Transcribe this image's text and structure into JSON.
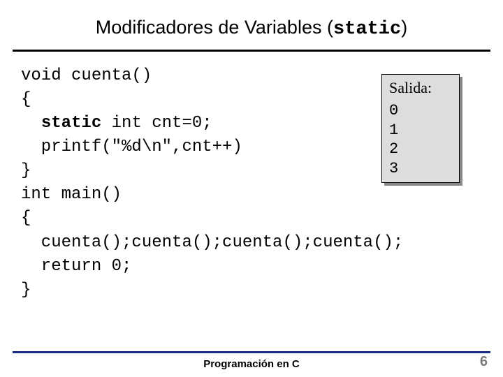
{
  "title": {
    "prefix": "Modificadores de Variables (",
    "mono": "static",
    "suffix": ")"
  },
  "code": {
    "l1": "void cuenta()",
    "l2": "{",
    "l3a": "  ",
    "l3b": "static",
    "l3c": " int cnt=0;",
    "l4": "  printf(\"%d\\n\",cnt++)",
    "l5": "}",
    "l6": "int main()",
    "l7": "{",
    "l8": "  cuenta();cuenta();cuenta();cuenta();",
    "l9": "  return 0;",
    "l10": "}"
  },
  "output": {
    "label": "Salida:",
    "lines": "0\n1\n2\n3"
  },
  "footer": {
    "text": "Programación en C",
    "page": "6"
  }
}
